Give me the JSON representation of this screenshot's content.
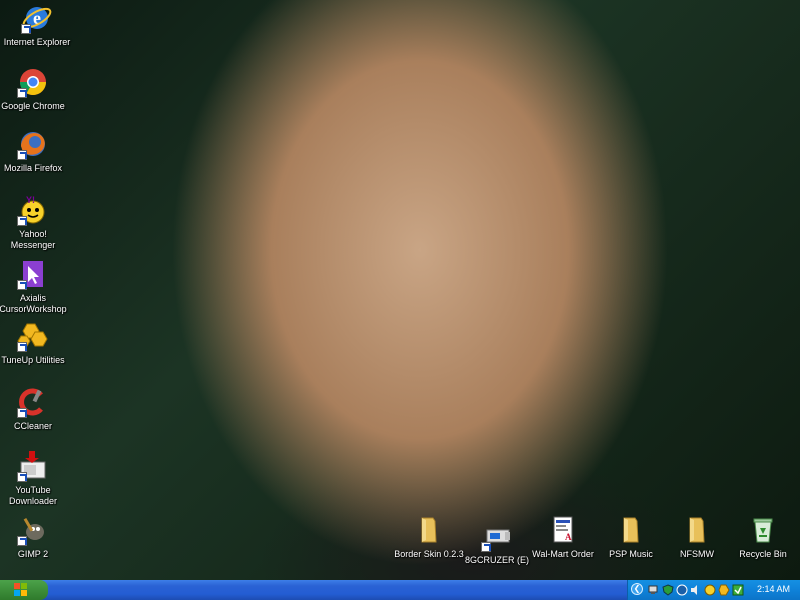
{
  "desktop_icons": [
    {
      "label": "Internet Explorer",
      "icon": "internet-explorer-icon"
    },
    {
      "label": "Google Chrome",
      "icon": "google-chrome-icon"
    },
    {
      "label": "Mozilla Firefox",
      "icon": "firefox-icon"
    },
    {
      "label": "Yahoo! Messenger",
      "icon": "yahoo-messenger-icon"
    },
    {
      "label": "Axialis CursorWorkshop",
      "icon": "cursor-workshop-icon"
    },
    {
      "label": "TuneUp Utilities",
      "icon": "tuneup-icon"
    },
    {
      "label": "CCleaner",
      "icon": "ccleaner-icon"
    },
    {
      "label": "YouTube Downloader",
      "icon": "youtube-downloader-icon"
    },
    {
      "label": "GIMP 2",
      "icon": "gimp-icon"
    },
    {
      "label": "Border Skin 0.2.3",
      "icon": "folder-icon"
    },
    {
      "label": "8GCRUZER (E)",
      "icon": "drive-icon"
    },
    {
      "label": "Wal-Mart Order",
      "icon": "document-icon"
    },
    {
      "label": "PSP Music",
      "icon": "folder-icon"
    },
    {
      "label": "NFSMW",
      "icon": "folder-icon"
    },
    {
      "label": "Recycle Bin",
      "icon": "recycle-bin-icon"
    }
  ],
  "taskbar": {
    "clock": "2:14 AM"
  },
  "colors": {
    "taskbar_blue": "#245dd3",
    "start_green": "#3d8e3a",
    "tray_blue": "#0f82d9"
  }
}
